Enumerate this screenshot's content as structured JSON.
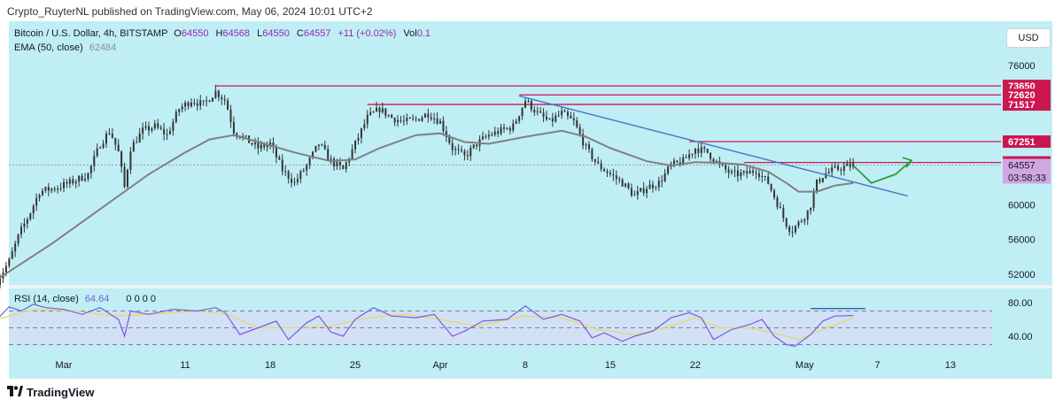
{
  "header": {
    "published": "Crypto_RuyterNL published on TradingView.com, May 06, 2024 10:01 UTC+2"
  },
  "currency_button": "USD",
  "legend": {
    "symbol": "Bitcoin / U.S. Dollar, 4h, BITSTAMP",
    "o_label": "O",
    "o_value": "64550",
    "h_label": "H",
    "h_value": "64568",
    "l_label": "L",
    "l_value": "64550",
    "c_label": "C",
    "c_value": "64557",
    "change": "+11 (+0.02%)",
    "vol_label": "Vol",
    "vol_value": "0.1",
    "ema_label": "EMA (50, close)",
    "ema_value": "62484"
  },
  "rsi_legend": {
    "label": "RSI (14, close)",
    "value": "64.64",
    "extra": "0 0 0 0"
  },
  "footer": {
    "brand": "TradingView"
  },
  "colors": {
    "background": "#bfeef5",
    "candles": "#333333",
    "ema": "#808080",
    "level_lines": "#cc1650",
    "trendline": "#4a78c8",
    "projection": "#2e9e3a",
    "price_tag": "#d2a6e0",
    "rsi_line": "#7b5be0",
    "rsi_ma": "#e3d96b"
  },
  "chart_data": {
    "type": "candlestick",
    "symbol": "Bitcoin / U.S. Dollar",
    "timeframe": "4h",
    "exchange": "BITSTAMP",
    "y_ticks": [
      76000,
      72000,
      68000,
      64000,
      60000,
      56000,
      52000
    ],
    "y_tick_labels_visible": [
      "76000",
      "60000",
      "56000",
      "52000"
    ],
    "ylim": [
      51000,
      77000
    ],
    "x_ticks": [
      {
        "label": "Mar",
        "day": 1
      },
      {
        "label": "11",
        "day": 11
      },
      {
        "label": "18",
        "day": 18
      },
      {
        "label": "25",
        "day": 25
      },
      {
        "label": "Apr",
        "day": 32
      },
      {
        "label": "8",
        "day": 39
      },
      {
        "label": "15",
        "day": 46
      },
      {
        "label": "22",
        "day": 53
      },
      {
        "label": "May",
        "day": 62
      },
      {
        "label": "7",
        "day": 68
      },
      {
        "label": "13",
        "day": 74
      }
    ],
    "close_path": [
      {
        "day": -4.5,
        "price": 51200
      },
      {
        "day": -3.5,
        "price": 53500
      },
      {
        "day": -2.7,
        "price": 56500
      },
      {
        "day": -1.8,
        "price": 59000
      },
      {
        "day": -1.0,
        "price": 61500
      },
      {
        "day": 0.5,
        "price": 62000
      },
      {
        "day": 2.0,
        "price": 62800
      },
      {
        "day": 3.0,
        "price": 63500
      },
      {
        "day": 4.0,
        "price": 67000
      },
      {
        "day": 4.8,
        "price": 68500
      },
      {
        "day": 5.5,
        "price": 66000
      },
      {
        "day": 6.0,
        "price": 62000
      },
      {
        "day": 6.5,
        "price": 66500
      },
      {
        "day": 7.5,
        "price": 68500
      },
      {
        "day": 8.5,
        "price": 69000
      },
      {
        "day": 9.5,
        "price": 68000
      },
      {
        "day": 10.5,
        "price": 71000
      },
      {
        "day": 11.5,
        "price": 72000
      },
      {
        "day": 12.5,
        "price": 71500
      },
      {
        "day": 13.5,
        "price": 73000
      },
      {
        "day": 14.3,
        "price": 72000
      },
      {
        "day": 15.0,
        "price": 68500
      },
      {
        "day": 16.0,
        "price": 67500
      },
      {
        "day": 17.0,
        "price": 66500
      },
      {
        "day": 18.0,
        "price": 67000
      },
      {
        "day": 19.0,
        "price": 64000
      },
      {
        "day": 20.0,
        "price": 62500
      },
      {
        "day": 21.0,
        "price": 64500
      },
      {
        "day": 22.0,
        "price": 67000
      },
      {
        "day": 23.0,
        "price": 65000
      },
      {
        "day": 24.0,
        "price": 64000
      },
      {
        "day": 25.0,
        "price": 67000
      },
      {
        "day": 26.0,
        "price": 70000
      },
      {
        "day": 27.0,
        "price": 71000
      },
      {
        "day": 28.0,
        "price": 70000
      },
      {
        "day": 29.0,
        "price": 69500
      },
      {
        "day": 30.0,
        "price": 69800
      },
      {
        "day": 31.0,
        "price": 70500
      },
      {
        "day": 32.0,
        "price": 69500
      },
      {
        "day": 33.0,
        "price": 66500
      },
      {
        "day": 34.0,
        "price": 65500
      },
      {
        "day": 35.0,
        "price": 67000
      },
      {
        "day": 36.0,
        "price": 68000
      },
      {
        "day": 37.0,
        "price": 68500
      },
      {
        "day": 38.0,
        "price": 69000
      },
      {
        "day": 39.0,
        "price": 72000
      },
      {
        "day": 40.0,
        "price": 70500
      },
      {
        "day": 41.0,
        "price": 69500
      },
      {
        "day": 42.0,
        "price": 70500
      },
      {
        "day": 43.0,
        "price": 69500
      },
      {
        "day": 44.0,
        "price": 66500
      },
      {
        "day": 45.0,
        "price": 64500
      },
      {
        "day": 46.0,
        "price": 63500
      },
      {
        "day": 47.0,
        "price": 62500
      },
      {
        "day": 48.0,
        "price": 61000
      },
      {
        "day": 49.0,
        "price": 62000
      },
      {
        "day": 50.0,
        "price": 62500
      },
      {
        "day": 51.0,
        "price": 64500
      },
      {
        "day": 52.0,
        "price": 65000
      },
      {
        "day": 53.0,
        "price": 66500
      },
      {
        "day": 54.0,
        "price": 66000
      },
      {
        "day": 55.0,
        "price": 64500
      },
      {
        "day": 56.0,
        "price": 63500
      },
      {
        "day": 57.0,
        "price": 63500
      },
      {
        "day": 58.0,
        "price": 64000
      },
      {
        "day": 59.0,
        "price": 62500
      },
      {
        "day": 59.8,
        "price": 60000
      },
      {
        "day": 60.4,
        "price": 58000
      },
      {
        "day": 60.9,
        "price": 57000
      },
      {
        "day": 61.6,
        "price": 58000
      },
      {
        "day": 62.4,
        "price": 59500
      },
      {
        "day": 63.0,
        "price": 62500
      },
      {
        "day": 63.6,
        "price": 63500
      },
      {
        "day": 64.4,
        "price": 64000
      },
      {
        "day": 65.2,
        "price": 64300
      },
      {
        "day": 66.0,
        "price": 64557
      }
    ],
    "ema_path": [
      {
        "day": -4.5,
        "price": 51400
      },
      {
        "day": 0.0,
        "price": 55500
      },
      {
        "day": 4.0,
        "price": 59500
      },
      {
        "day": 8.0,
        "price": 63500
      },
      {
        "day": 11.0,
        "price": 66000
      },
      {
        "day": 13.0,
        "price": 67500
      },
      {
        "day": 15.0,
        "price": 68000
      },
      {
        "day": 17.0,
        "price": 67200
      },
      {
        "day": 20.0,
        "price": 66000
      },
      {
        "day": 23.0,
        "price": 65000
      },
      {
        "day": 25.0,
        "price": 65200
      },
      {
        "day": 27.0,
        "price": 66500
      },
      {
        "day": 30.0,
        "price": 68000
      },
      {
        "day": 32.0,
        "price": 68200
      },
      {
        "day": 34.0,
        "price": 67200
      },
      {
        "day": 36.0,
        "price": 67000
      },
      {
        "day": 39.0,
        "price": 67800
      },
      {
        "day": 42.0,
        "price": 68500
      },
      {
        "day": 44.0,
        "price": 67800
      },
      {
        "day": 46.0,
        "price": 66500
      },
      {
        "day": 49.0,
        "price": 65000
      },
      {
        "day": 51.0,
        "price": 64500
      },
      {
        "day": 53.0,
        "price": 64900
      },
      {
        "day": 55.0,
        "price": 64800
      },
      {
        "day": 57.0,
        "price": 64600
      },
      {
        "day": 59.0,
        "price": 63800
      },
      {
        "day": 60.5,
        "price": 62500
      },
      {
        "day": 61.5,
        "price": 61500
      },
      {
        "day": 63.0,
        "price": 61500
      },
      {
        "day": 64.5,
        "price": 62200
      },
      {
        "day": 66.0,
        "price": 62484
      }
    ],
    "levels": [
      {
        "label": "73650",
        "value": 73650,
        "from_day": 13.5
      },
      {
        "label": "72620",
        "value": 72620,
        "from_day": 38.5
      },
      {
        "label": "71517",
        "value": 71517,
        "from_day": 26.0
      },
      {
        "label": "67251",
        "value": 67251,
        "from_day": 52.5
      },
      {
        "label": "64855",
        "value": 64855,
        "from_day": 57.0
      }
    ],
    "current_price": {
      "label": "64557",
      "countdown": "03:58:33",
      "value": 64557
    },
    "trendline": [
      {
        "day": 38.5,
        "price": 72500
      },
      {
        "day": 70.5,
        "price": 61000
      }
    ],
    "projection": [
      {
        "day": 66.0,
        "price": 64500
      },
      {
        "day": 67.5,
        "price": 62500
      },
      {
        "day": 69.5,
        "price": 63500
      },
      {
        "day": 70.8,
        "price": 65100
      }
    ],
    "rsi": {
      "period": 14,
      "value": 64.64,
      "bands": [
        70,
        50,
        30
      ],
      "y_tick_labels": [
        "80.00",
        "40.00"
      ],
      "path": [
        {
          "day": -4.5,
          "price": 60
        },
        {
          "day": -3.5,
          "price": 75
        },
        {
          "day": -2.5,
          "price": 70
        },
        {
          "day": -1.5,
          "price": 78
        },
        {
          "day": -0.5,
          "price": 74
        },
        {
          "day": 1.0,
          "price": 72
        },
        {
          "day": 2.5,
          "price": 66
        },
        {
          "day": 4.0,
          "price": 74
        },
        {
          "day": 5.5,
          "price": 60
        },
        {
          "day": 6.0,
          "price": 40
        },
        {
          "day": 6.5,
          "price": 70
        },
        {
          "day": 8.0,
          "price": 66
        },
        {
          "day": 10.0,
          "price": 72
        },
        {
          "day": 12.0,
          "price": 70
        },
        {
          "day": 13.5,
          "price": 74
        },
        {
          "day": 14.3,
          "price": 68
        },
        {
          "day": 15.5,
          "price": 42
        },
        {
          "day": 17.0,
          "price": 50
        },
        {
          "day": 18.5,
          "price": 58
        },
        {
          "day": 19.5,
          "price": 36
        },
        {
          "day": 21.0,
          "price": 56
        },
        {
          "day": 22.0,
          "price": 64
        },
        {
          "day": 23.0,
          "price": 45
        },
        {
          "day": 24.0,
          "price": 40
        },
        {
          "day": 25.0,
          "price": 60
        },
        {
          "day": 26.5,
          "price": 74
        },
        {
          "day": 28.0,
          "price": 64
        },
        {
          "day": 30.0,
          "price": 62
        },
        {
          "day": 31.5,
          "price": 66
        },
        {
          "day": 33.0,
          "price": 40
        },
        {
          "day": 34.0,
          "price": 46
        },
        {
          "day": 35.5,
          "price": 58
        },
        {
          "day": 37.5,
          "price": 60
        },
        {
          "day": 39.0,
          "price": 76
        },
        {
          "day": 40.5,
          "price": 60
        },
        {
          "day": 42.0,
          "price": 66
        },
        {
          "day": 43.5,
          "price": 58
        },
        {
          "day": 44.5,
          "price": 38
        },
        {
          "day": 45.5,
          "price": 44
        },
        {
          "day": 47.0,
          "price": 34
        },
        {
          "day": 48.0,
          "price": 40
        },
        {
          "day": 49.5,
          "price": 46
        },
        {
          "day": 51.0,
          "price": 62
        },
        {
          "day": 52.5,
          "price": 68
        },
        {
          "day": 53.5,
          "price": 62
        },
        {
          "day": 54.5,
          "price": 36
        },
        {
          "day": 56.0,
          "price": 48
        },
        {
          "day": 57.5,
          "price": 54
        },
        {
          "day": 58.5,
          "price": 60
        },
        {
          "day": 59.5,
          "price": 40
        },
        {
          "day": 60.5,
          "price": 30
        },
        {
          "day": 61.2,
          "price": 28
        },
        {
          "day": 62.5,
          "price": 42
        },
        {
          "day": 63.5,
          "price": 58
        },
        {
          "day": 64.5,
          "price": 64
        },
        {
          "day": 66.0,
          "price": 64.64
        }
      ],
      "ma_path": [
        {
          "day": -4.5,
          "price": 60
        },
        {
          "day": -1.5,
          "price": 72
        },
        {
          "day": 2.0,
          "price": 70
        },
        {
          "day": 5.0,
          "price": 64
        },
        {
          "day": 8.0,
          "price": 66
        },
        {
          "day": 12.0,
          "price": 70
        },
        {
          "day": 14.5,
          "price": 66
        },
        {
          "day": 17.0,
          "price": 50
        },
        {
          "day": 20.0,
          "price": 50
        },
        {
          "day": 23.0,
          "price": 52
        },
        {
          "day": 26.0,
          "price": 62
        },
        {
          "day": 29.0,
          "price": 66
        },
        {
          "day": 32.0,
          "price": 60
        },
        {
          "day": 35.0,
          "price": 52
        },
        {
          "day": 39.0,
          "price": 64
        },
        {
          "day": 42.0,
          "price": 62
        },
        {
          "day": 45.0,
          "price": 48
        },
        {
          "day": 48.0,
          "price": 42
        },
        {
          "day": 51.0,
          "price": 52
        },
        {
          "day": 53.0,
          "price": 62
        },
        {
          "day": 55.0,
          "price": 50
        },
        {
          "day": 57.5,
          "price": 50
        },
        {
          "day": 60.0,
          "price": 42
        },
        {
          "day": 61.5,
          "price": 36
        },
        {
          "day": 63.5,
          "price": 48
        },
        {
          "day": 66.0,
          "price": 62
        }
      ]
    }
  }
}
